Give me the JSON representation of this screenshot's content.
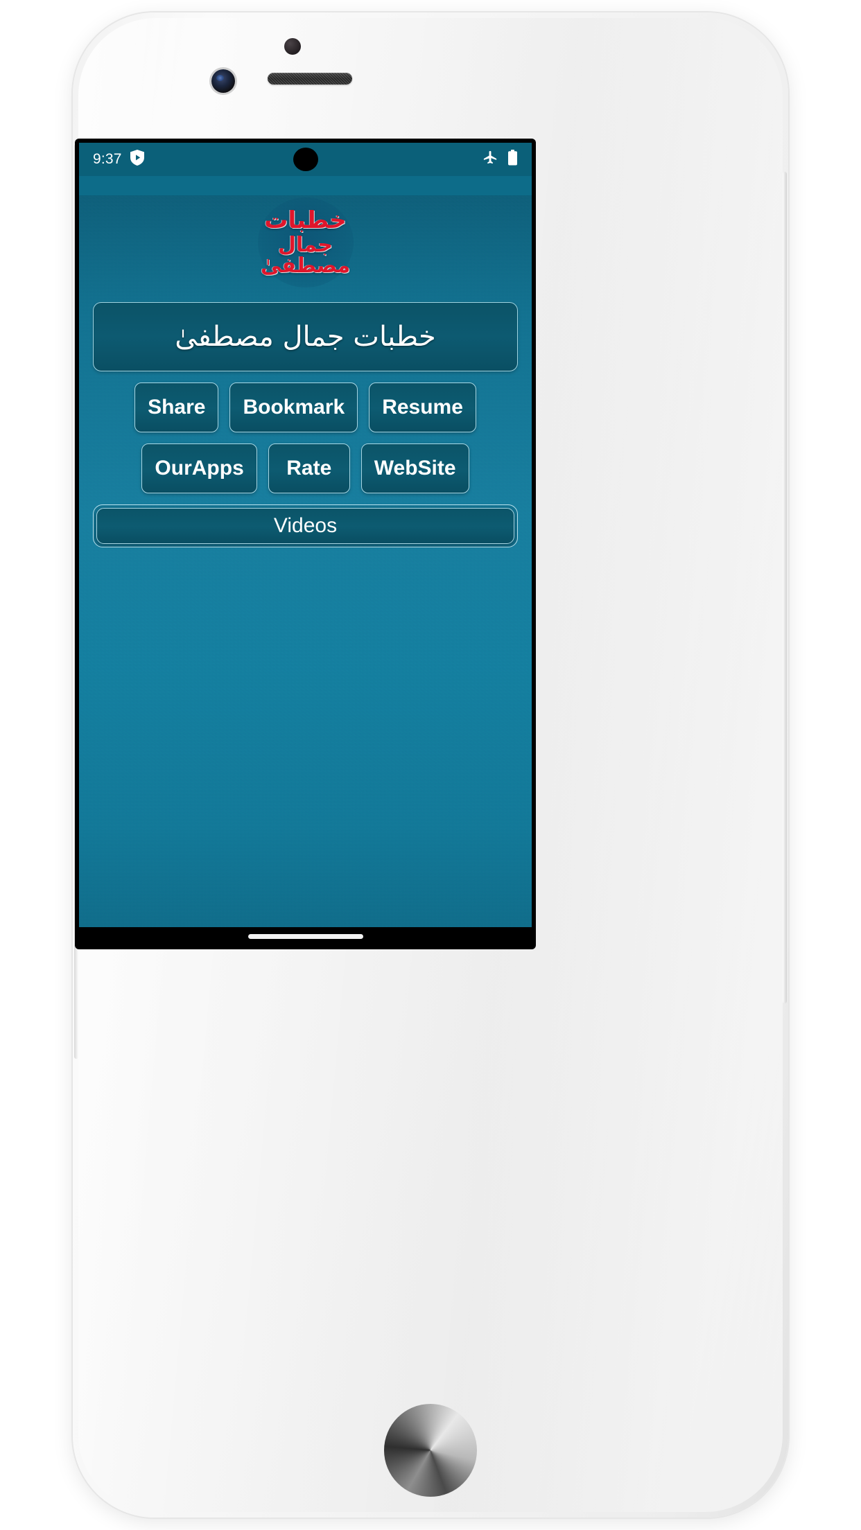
{
  "device": {
    "type": "smartphone-mockup",
    "hardware": {
      "earpiece": "earpiece-speaker",
      "front_camera": "front-camera-lens",
      "sensor": "proximity-sensor",
      "home_button": "home-button"
    }
  },
  "status_bar": {
    "time": "9:37",
    "left_icons": [
      "shield-play-icon"
    ],
    "right_icons": [
      "airplane-mode-icon",
      "battery-full-icon"
    ],
    "punch_hole_camera": true,
    "background_color": "#0b6079",
    "text_color": "#ffffff"
  },
  "app": {
    "background_color": "#1580a0",
    "logo": {
      "line1": "خطبات",
      "line2": "جمال مصطفیٰ",
      "color": "#e0162b",
      "shape": "circular-disc"
    },
    "title_banner": {
      "text": "خطبات جمال مصطفیٰ",
      "text_color": "#ffffff",
      "background_color": "#0d5a71",
      "border_color": "#9fd3e0"
    },
    "buttons": {
      "row1": [
        {
          "label": "Share",
          "name": "share-button"
        },
        {
          "label": "Bookmark",
          "name": "bookmark-button"
        },
        {
          "label": "Resume",
          "name": "resume-button"
        }
      ],
      "row2": [
        {
          "label": "OurApps",
          "name": "ourapps-button"
        },
        {
          "label": "Rate",
          "name": "rate-button"
        },
        {
          "label": "WebSite",
          "name": "website-button"
        }
      ],
      "videos": {
        "label": "Videos",
        "name": "videos-button"
      }
    },
    "button_style": {
      "background_color": "#0d5b71",
      "border_color": "#a7d7e4",
      "text_color": "#ffffff"
    }
  },
  "navigation_bar": {
    "style": "gesture-pill",
    "background_color": "#000000",
    "pill_color": "#f2f2f2"
  }
}
